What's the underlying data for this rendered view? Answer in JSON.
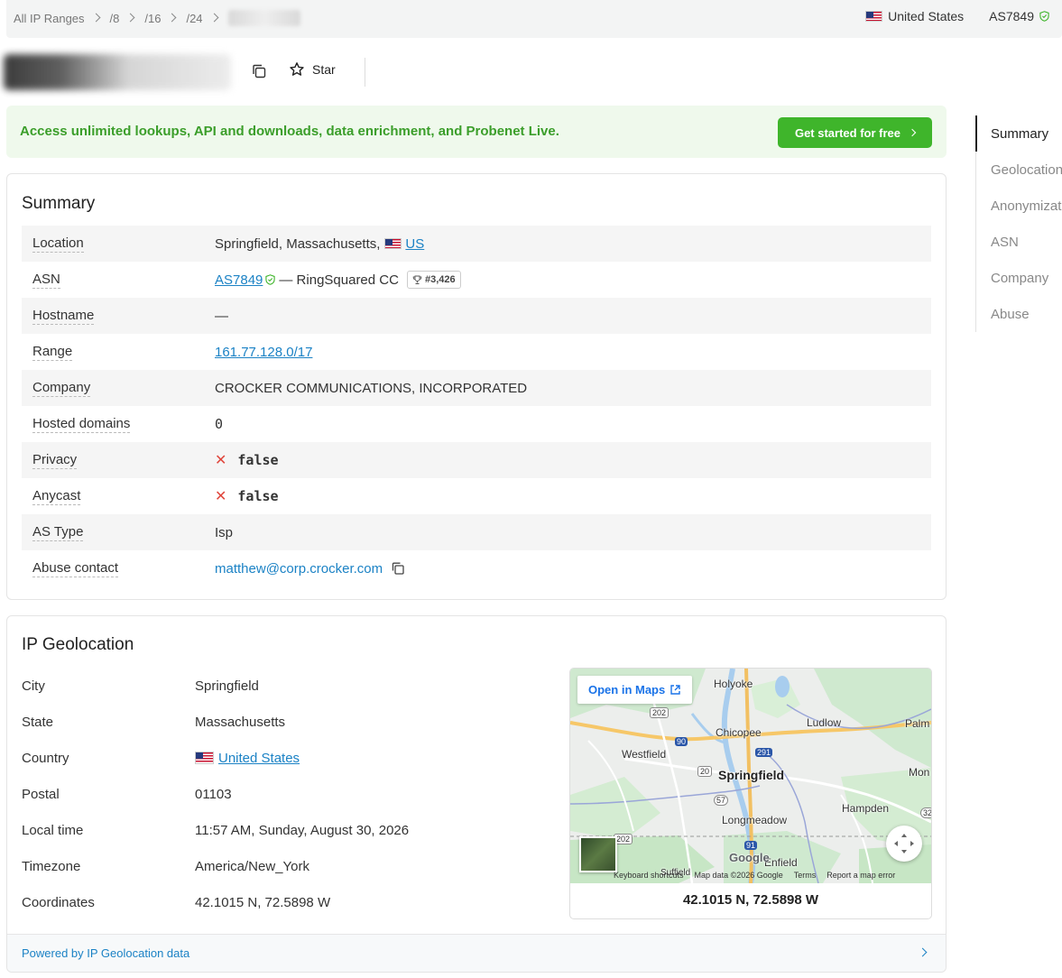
{
  "breadcrumb": {
    "items": [
      "All IP Ranges",
      "/8",
      "/16",
      "/24"
    ]
  },
  "topbar": {
    "country": "United States",
    "asn": "AS7849"
  },
  "header": {
    "star_label": "Star"
  },
  "promo": {
    "text": "Access unlimited lookups, API and downloads, data enrichment, and Probenet Live.",
    "button_label": "Get started for free"
  },
  "summary": {
    "title": "Summary",
    "location_label": "Location",
    "location_value": "Springfield, Massachusetts,",
    "location_country": "US",
    "asn_label": "ASN",
    "asn_link": "AS7849",
    "asn_name": "— RingSquared CC",
    "asn_rank": "#3,426",
    "hostname_label": "Hostname",
    "hostname_value": "—",
    "range_label": "Range",
    "range_value": "161.77.128.0/17",
    "company_label": "Company",
    "company_value": "CROCKER COMMUNICATIONS, INCORPORATED",
    "hosted_label": "Hosted domains",
    "hosted_value": "0",
    "privacy_label": "Privacy",
    "privacy_value": "false",
    "anycast_label": "Anycast",
    "anycast_value": "false",
    "astype_label": "AS Type",
    "astype_value": "Isp",
    "abuse_label": "Abuse contact",
    "abuse_value": "matthew@corp.crocker.com"
  },
  "geolocation": {
    "title": "IP Geolocation",
    "city_label": "City",
    "city_value": "Springfield",
    "state_label": "State",
    "state_value": "Massachusetts",
    "country_label": "Country",
    "country_value": "United States",
    "postal_label": "Postal",
    "postal_value": "01103",
    "localtime_label": "Local time",
    "localtime_value": "11:57 AM, Sunday, August 30, 2026",
    "timezone_label": "Timezone",
    "timezone_value": "America/New_York",
    "coords_label": "Coordinates",
    "coords_value": "42.1015 N, 72.5898 W",
    "footer_text": "Powered by IP Geolocation data"
  },
  "map": {
    "open_label": "Open in Maps",
    "caption": "42.1015 N, 72.5898 W",
    "places": {
      "holyoke": "Holyoke",
      "chicopee": "Chicopee",
      "ludlow": "Ludlow",
      "palm": "Palm",
      "westfield": "Westfield",
      "springfield": "Springfield",
      "mon": "Mon",
      "hampden": "Hampden",
      "longmeadow": "Longmeadow",
      "enfield": "Enfield",
      "suffield": "Suffield"
    },
    "route_labels": {
      "r202a": "202",
      "r90": "90",
      "r291": "291",
      "r20": "20",
      "r57": "57",
      "r202b": "202",
      "r91": "91",
      "r32": "32"
    },
    "attribution": {
      "shortcuts": "Keyboard shortcuts",
      "data": "Map data ©2026 Google",
      "terms": "Terms",
      "report": "Report a map error"
    },
    "logo": "Google"
  },
  "sidenav": {
    "items": [
      "Summary",
      "Geolocation",
      "Anonymization",
      "ASN",
      "Company",
      "Abuse"
    ],
    "active": "Summary"
  },
  "colors": {
    "accent_link": "#1b82c5",
    "promo_green": "#3fb52b",
    "promo_text": "#3b9e2a",
    "false_red": "#e0463c"
  }
}
